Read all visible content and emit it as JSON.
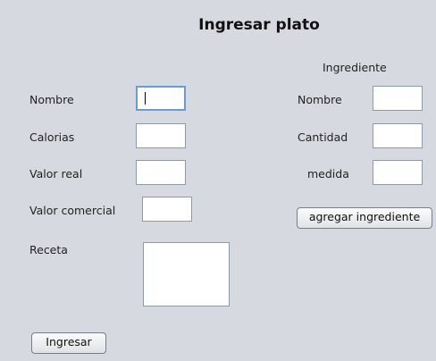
{
  "window": {
    "title": "Ingresar plato"
  },
  "form": {
    "nombre_label": "Nombre",
    "calorias_label": "Calorias",
    "valor_real_label": "Valor real",
    "valor_comercial_label": "Valor comercial",
    "receta_label": "Receta",
    "nombre_value": "",
    "calorias_value": "",
    "valor_real_value": "",
    "valor_comercial_value": "",
    "receta_value": ""
  },
  "ingrediente": {
    "header": "Ingrediente",
    "nombre_label": "Nombre",
    "cantidad_label": "Cantidad",
    "medida_label": "medida",
    "nombre_value": "",
    "cantidad_value": "",
    "medida_value": "",
    "add_button": "agregar ingrediente"
  },
  "actions": {
    "submit_button": "Ingresar"
  }
}
